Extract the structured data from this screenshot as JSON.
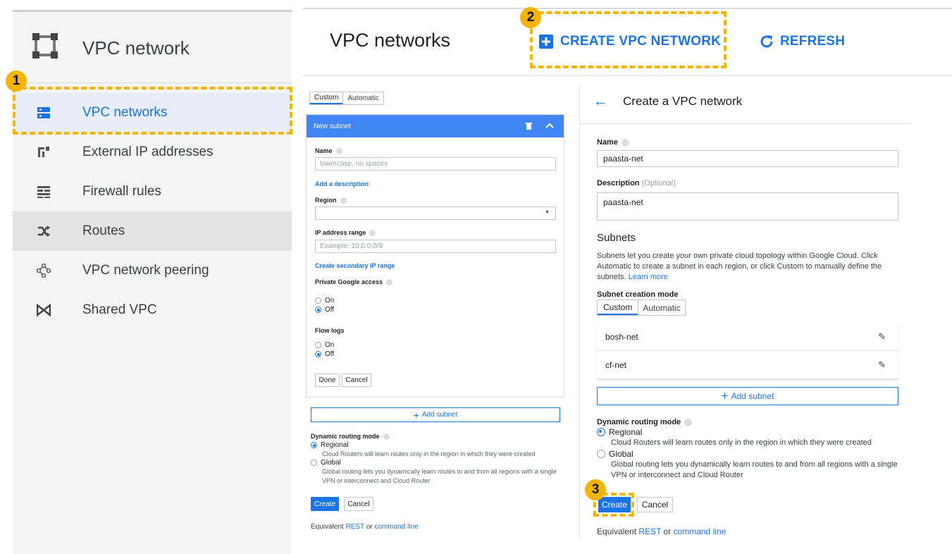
{
  "sidebar": {
    "title": "VPC network",
    "items": [
      {
        "label": "VPC networks",
        "icon": "vpc-networks-icon",
        "state": "active"
      },
      {
        "label": "External IP addresses",
        "icon": "external-ip-icon",
        "state": ""
      },
      {
        "label": "Firewall rules",
        "icon": "firewall-icon",
        "state": ""
      },
      {
        "label": "Routes",
        "icon": "routes-icon",
        "state": "hover"
      },
      {
        "label": "VPC network peering",
        "icon": "peering-icon",
        "state": ""
      },
      {
        "label": "Shared VPC",
        "icon": "shared-vpc-icon",
        "state": ""
      }
    ]
  },
  "header": {
    "title": "VPC networks",
    "create_label": "CREATE VPC NETWORK",
    "refresh_label": "REFRESH"
  },
  "badges": {
    "one": "1",
    "two": "2",
    "three": "3"
  },
  "subnet_form": {
    "tabs": [
      "Custom",
      "Automatic"
    ],
    "card_title": "New subnet",
    "name_label": "Name",
    "name_placeholder": "lowercase, no spaces",
    "add_description": "Add a description",
    "region_label": "Region",
    "ip_label": "IP address range",
    "ip_placeholder": "Example: 10.0.0.0/9",
    "secondary_link": "Create secondary IP range",
    "pga_label": "Private Google access",
    "on": "On",
    "off": "Off",
    "flow_label": "Flow logs",
    "done": "Done",
    "cancel": "Cancel",
    "add_subnet": "Add subnet",
    "routing_label": "Dynamic routing mode",
    "regional": "Regional",
    "regional_desc": "Cloud Routers will learn routes only in the region in which they were created",
    "global": "Global",
    "global_desc_1": "Global routing lets you dynamically learn routes to and from all regions with a single",
    "global_desc_2": "VPN or interconnect and Cloud Router",
    "create": "Create",
    "equivalent": "Equivalent",
    "rest": "REST",
    "or": "or",
    "command_line": "command line"
  },
  "create_panel": {
    "title": "Create a VPC network",
    "name_label": "Name",
    "name_value": "paasta-net",
    "desc_label": "Description",
    "desc_optional": "(Optional)",
    "desc_value": "paasta-net",
    "subnets_heading": "Subnets",
    "subnets_text_1": "Subnets let you create your own private cloud topology within Google Cloud. Click",
    "subnets_text_2": "Automatic to create a subnet in each region, or click Custom to manually define the",
    "subnets_text_3": "subnets.",
    "learn_more": "Learn more",
    "mode_label": "Subnet creation mode",
    "tabs": [
      "Custom",
      "Automatic"
    ],
    "subnets": [
      "bosh-net",
      "cf-net"
    ],
    "add_subnet": "Add subnet",
    "routing_label": "Dynamic routing mode",
    "regional": "Regional",
    "regional_desc": "Cloud Routers will learn routes only in the region in which they were created",
    "global": "Global",
    "global_desc_1": "Global routing lets you dynamically learn routes to and from all regions with a single",
    "global_desc_2": "VPN or interconnect and Cloud Router",
    "create": "Create",
    "cancel": "Cancel",
    "equivalent": "Equivalent",
    "rest": "REST",
    "or": "or",
    "command_line": "command line"
  },
  "colors": {
    "accent": "#1a73e8",
    "highlight": "#f4b400",
    "card_header": "#4285f4"
  }
}
